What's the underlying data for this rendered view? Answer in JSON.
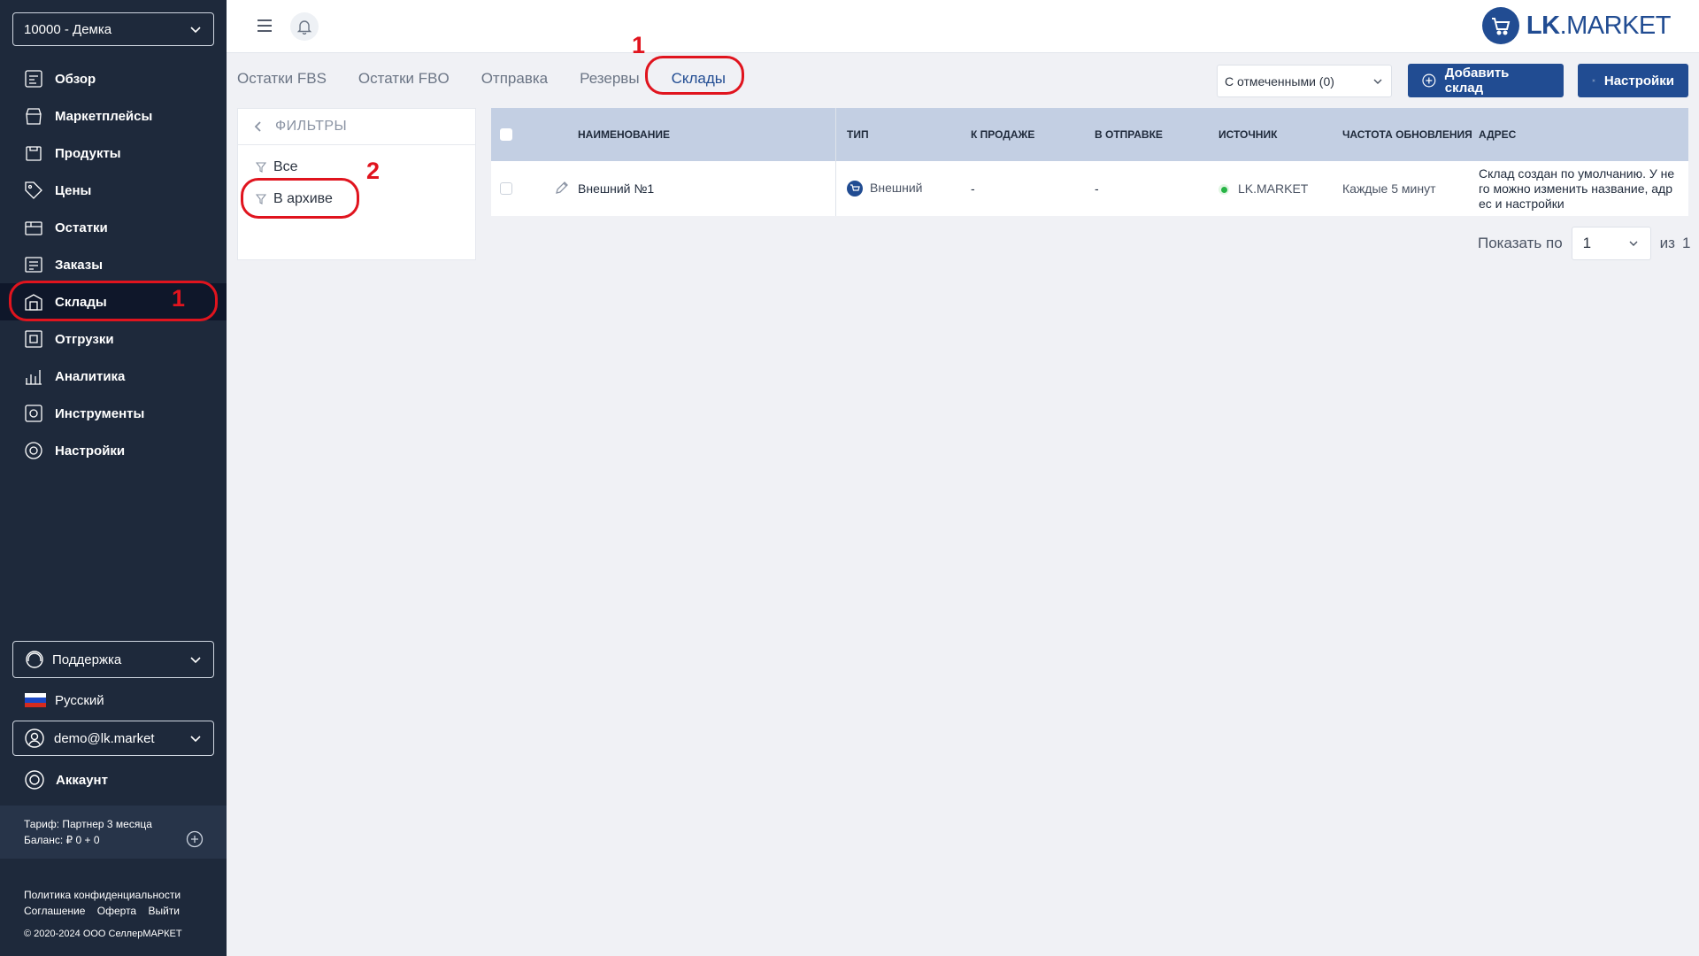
{
  "sidebar": {
    "org": "10000 - Демка",
    "items": [
      {
        "label": "Обзор",
        "icon": "overview-icon"
      },
      {
        "label": "Маркетплейсы",
        "icon": "marketplaces-icon"
      },
      {
        "label": "Продукты",
        "icon": "products-icon"
      },
      {
        "label": "Цены",
        "icon": "prices-icon"
      },
      {
        "label": "Остатки",
        "icon": "stock-icon"
      },
      {
        "label": "Заказы",
        "icon": "orders-icon"
      },
      {
        "label": "Склады",
        "icon": "warehouses-icon",
        "active": true
      },
      {
        "label": "Отгрузки",
        "icon": "shipments-icon"
      },
      {
        "label": "Аналитика",
        "icon": "analytics-icon"
      },
      {
        "label": "Инструменты",
        "icon": "tools-icon"
      },
      {
        "label": "Настройки",
        "icon": "settings-icon"
      }
    ],
    "support": "Поддержка",
    "language": "Русский",
    "user": "demo@lk.market",
    "account": "Аккаунт",
    "tariff": "Тариф: Партнер 3 месяца",
    "balance": "Баланс: ₽ 0 + 0",
    "footer": {
      "privacy": "Политика конфиденциальности",
      "agreement": "Соглашение",
      "offer": "Оферта",
      "logout": "Выйти",
      "copyright": "© 2020-2024 ООО СеллерМАРКЕТ"
    }
  },
  "header": {
    "logo_bold": "LK",
    "logo_rest": ".MARKET"
  },
  "tabs": [
    {
      "label": "Остатки FBS"
    },
    {
      "label": "Остатки FBO"
    },
    {
      "label": "Отправка"
    },
    {
      "label": "Резервы"
    },
    {
      "label": "Склады",
      "active": true
    }
  ],
  "toolbar": {
    "bulk_action": "С отмеченными (0)",
    "add_warehouse": "Добавить склад",
    "settings": "Настройки"
  },
  "filters": {
    "title": "ФИЛЬТРЫ",
    "items": [
      "Все",
      "В архиве"
    ]
  },
  "table": {
    "columns": [
      "НАИМЕНОВАНИЕ",
      "ТИП",
      "К ПРОДАЖЕ",
      "В ОТПРАВКЕ",
      "ИСТОЧНИК",
      "ЧАСТОТА ОБНОВЛЕНИЯ",
      "АДРЕС"
    ],
    "rows": [
      {
        "name": "Внешний №1",
        "type": "Внешний",
        "for_sale": "-",
        "in_shipping": "-",
        "source": "LK.MARKET",
        "frequency": "Каждые 5 минут",
        "address": "Склад создан по умолчанию. У не го можно изменить название, адр ес и настройки"
      }
    ]
  },
  "pager": {
    "label": "Показать по",
    "value": "1",
    "of": "из",
    "total": "1"
  },
  "annotations": {
    "tab_marker": "1",
    "nav_marker": "1",
    "filter_marker": "2",
    "color": "#e0141e"
  },
  "colors": {
    "sidebar_bg": "#1e293b",
    "accent": "#214c92",
    "table_header": "#c3cfe3"
  }
}
